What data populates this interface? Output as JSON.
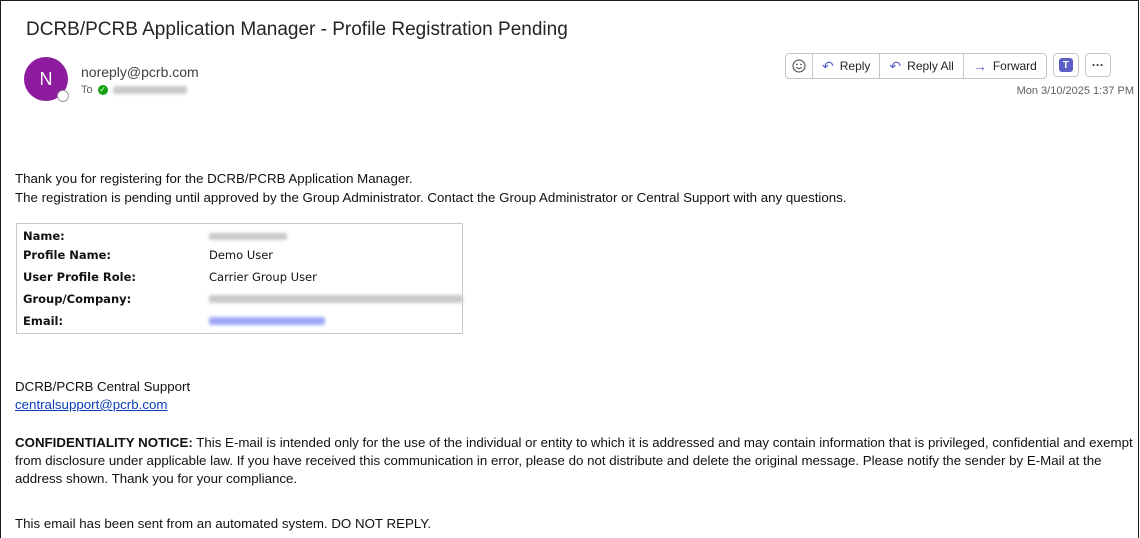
{
  "email": {
    "subject": "DCRB/PCRB Application Manager - Profile Registration Pending",
    "avatar_initial": "N",
    "sender": "noreply@pcrb.com",
    "to_label": "To",
    "date": "Mon 3/10/2025 1:37 PM"
  },
  "toolbar": {
    "emoji_icon": "smiley-icon",
    "reply_label": "Reply",
    "reply_all_label": "Reply All",
    "forward_label": "Forward",
    "teams_icon": "teams-icon",
    "more_label": "···"
  },
  "body": {
    "line1": "Thank you for registering for the DCRB/PCRB Application Manager.",
    "line2": "The registration is pending until approved by the Group Administrator. Contact the Group Administrator or Central Support with any questions.",
    "table": {
      "name_label": "Name:",
      "profile_name_label": "Profile Name:",
      "profile_name_value": "Demo User",
      "role_label": "User Profile Role:",
      "role_value": "Carrier Group User",
      "group_label": "Group/Company:",
      "email_label": "Email:"
    },
    "support_name": "DCRB/PCRB Central Support",
    "support_email": "centralsupport@pcrb.com",
    "confidentiality_heading": "CONFIDENTIALITY NOTICE:",
    "confidentiality_text": " This E-mail is intended only for the use of the individual or entity to which it is addressed and may contain information that is privileged, confidential and exempt from disclosure under applicable law. If you have received this communication in error, please do not distribute and delete the original message. Please notify the sender by E-Mail at the address shown. Thank you for your compliance.",
    "automated_notice": "This email has been sent from an automated system. DO NOT REPLY."
  },
  "colors": {
    "avatar": "#8c1b9e",
    "accent": "#5b5fc7",
    "link": "#0b3fb8"
  }
}
